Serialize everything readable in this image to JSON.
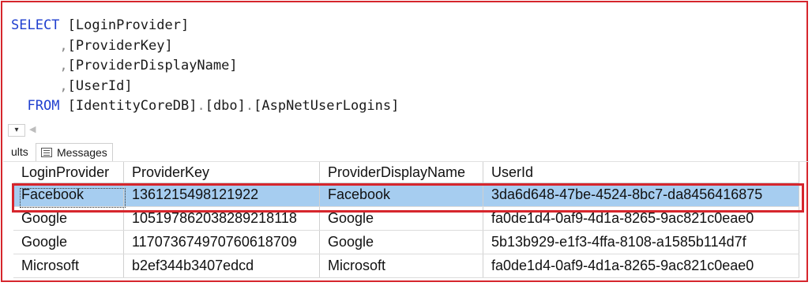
{
  "query": {
    "line1_kw": "SELECT",
    "line1_rest": "[LoginProvider]",
    "line2": "[ProviderKey]",
    "line3": "[ProviderDisplayName]",
    "line4": "[UserId]",
    "line5_kw": "FROM",
    "line5_db": "[IdentityCoreDB]",
    "line5_schema": "[dbo]",
    "line5_table": "[AspNetUserLogins]",
    "comma": ",",
    "dot": "."
  },
  "tabs": {
    "results_label": "ults",
    "messages_label": "Messages"
  },
  "grid": {
    "columns": [
      "LoginProvider",
      "ProviderKey",
      "ProviderDisplayName",
      "UserId"
    ],
    "rows": [
      [
        "Facebook",
        "1361215498121922",
        "Facebook",
        "3da6d648-47be-4524-8bc7-da8456416875"
      ],
      [
        "Google",
        "105197862038289218118",
        "Google",
        "fa0de1d4-0af9-4d1a-8265-9ac821c0eae0"
      ],
      [
        "Google",
        "117073674970760618709",
        "Google",
        "5b13b929-e1f3-4ffa-8108-a1585b114d7f"
      ],
      [
        "Microsoft",
        "b2ef344b3407edcd",
        "Microsoft",
        "fa0de1d4-0af9-4d1a-8265-9ac821c0eae0"
      ]
    ],
    "selected_row": 0
  }
}
